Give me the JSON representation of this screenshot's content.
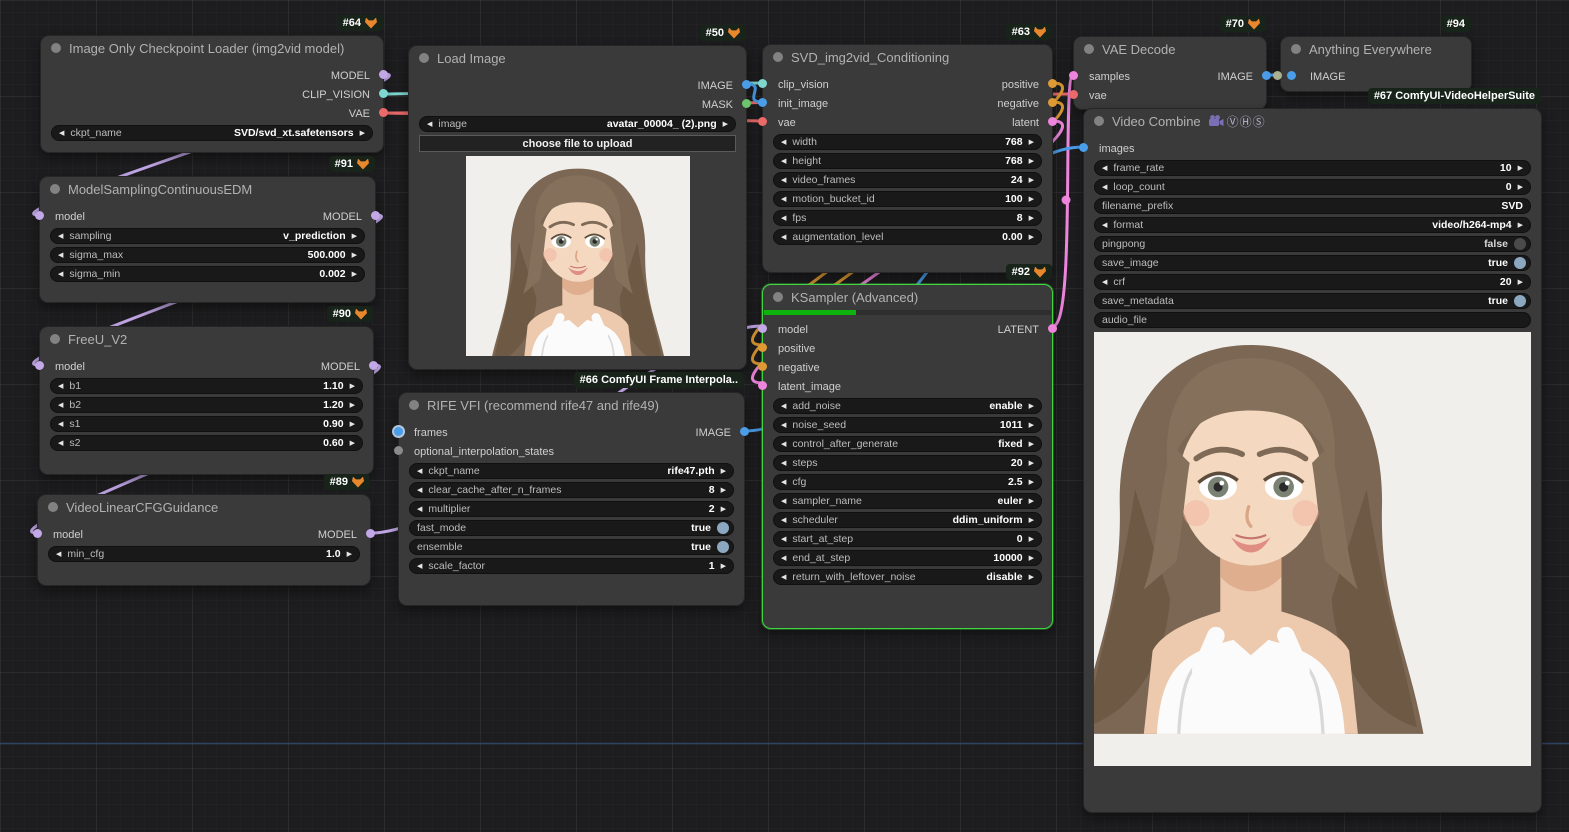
{
  "colors": {
    "model": "#c3a8e8",
    "clip_vision": "#7fd6cf",
    "vae": "#ea6a6a",
    "image": "#4a9de8",
    "mask": "#6cc46c",
    "conditioning": "#dd9933",
    "latent": "#ee85dd",
    "link_faint": "#35507c",
    "unconnected": "#8a8a8a",
    "anywhere_in": "#a8b08f",
    "progress": "#0eb30e"
  },
  "nodes": {
    "checkpoint_loader": {
      "badge": "#64",
      "title": "Image Only Checkpoint Loader (img2vid model)",
      "outputs": {
        "model": "MODEL",
        "clip_vision": "CLIP_VISION",
        "vae": "VAE"
      },
      "widgets": {
        "ckpt_name": {
          "label": "ckpt_name",
          "value": "SVD/svd_xt.safetensors"
        }
      }
    },
    "model_sampling": {
      "badge": "#91",
      "title": "ModelSamplingContinuousEDM",
      "inputs": {
        "model": "model"
      },
      "outputs": {
        "model": "MODEL"
      },
      "widgets": {
        "sampling": {
          "label": "sampling",
          "value": "v_prediction"
        },
        "sigma_max": {
          "label": "sigma_max",
          "value": "500.000"
        },
        "sigma_min": {
          "label": "sigma_min",
          "value": "0.002"
        }
      }
    },
    "freeu": {
      "badge": "#90",
      "title": "FreeU_V2",
      "inputs": {
        "model": "model"
      },
      "outputs": {
        "model": "MODEL"
      },
      "widgets": {
        "b1": {
          "label": "b1",
          "value": "1.10"
        },
        "b2": {
          "label": "b2",
          "value": "1.20"
        },
        "s1": {
          "label": "s1",
          "value": "0.90"
        },
        "s2": {
          "label": "s2",
          "value": "0.60"
        }
      }
    },
    "cfg_guidance": {
      "badge": "#89",
      "title": "VideoLinearCFGGuidance",
      "inputs": {
        "model": "model"
      },
      "outputs": {
        "model": "MODEL"
      },
      "widgets": {
        "min_cfg": {
          "label": "min_cfg",
          "value": "1.0"
        }
      }
    },
    "load_image": {
      "badge": "#50",
      "title": "Load Image",
      "outputs": {
        "image": "IMAGE",
        "mask": "MASK"
      },
      "widgets": {
        "image": {
          "label": "image",
          "value": "avatar_00004_ (2).png"
        },
        "upload": {
          "label": "choose file to upload"
        }
      }
    },
    "rife": {
      "badge": "#66 ComfyUI Frame Interpola..",
      "title": "RIFE VFI (recommend rife47 and rife49)",
      "inputs": {
        "frames": "frames",
        "optional": "optional_interpolation_states"
      },
      "outputs": {
        "image": "IMAGE"
      },
      "widgets": {
        "ckpt_name": {
          "label": "ckpt_name",
          "value": "rife47.pth"
        },
        "clear_cache": {
          "label": "clear_cache_after_n_frames",
          "value": "8"
        },
        "multiplier": {
          "label": "multiplier",
          "value": "2"
        },
        "fast_mode": {
          "label": "fast_mode",
          "value": "true"
        },
        "ensemble": {
          "label": "ensemble",
          "value": "true"
        },
        "scale_factor": {
          "label": "scale_factor",
          "value": "1"
        }
      }
    },
    "svd_conditioning": {
      "badge": "#63",
      "title": "SVD_img2vid_Conditioning",
      "inputs": {
        "clip_vision": "clip_vision",
        "init_image": "init_image",
        "vae": "vae"
      },
      "outputs": {
        "positive": "positive",
        "negative": "negative",
        "latent": "latent"
      },
      "widgets": {
        "width": {
          "label": "width",
          "value": "768"
        },
        "height": {
          "label": "height",
          "value": "768"
        },
        "video_frames": {
          "label": "video_frames",
          "value": "24"
        },
        "motion_bucket_id": {
          "label": "motion_bucket_id",
          "value": "100"
        },
        "fps": {
          "label": "fps",
          "value": "8"
        },
        "augmentation_level": {
          "label": "augmentation_level",
          "value": "0.00"
        }
      }
    },
    "ksampler": {
      "badge": "#92",
      "title": "KSampler (Advanced)",
      "inputs": {
        "model": "model",
        "positive": "positive",
        "negative": "negative",
        "latent_image": "latent_image"
      },
      "outputs": {
        "latent": "LATENT"
      },
      "widgets": {
        "add_noise": {
          "label": "add_noise",
          "value": "enable"
        },
        "noise_seed": {
          "label": "noise_seed",
          "value": "1011"
        },
        "control_after_generate": {
          "label": "control_after_generate",
          "value": "fixed"
        },
        "steps": {
          "label": "steps",
          "value": "20"
        },
        "cfg": {
          "label": "cfg",
          "value": "2.5"
        },
        "sampler_name": {
          "label": "sampler_name",
          "value": "euler"
        },
        "scheduler": {
          "label": "scheduler",
          "value": "ddim_uniform"
        },
        "start_at_step": {
          "label": "start_at_step",
          "value": "0"
        },
        "end_at_step": {
          "label": "end_at_step",
          "value": "10000"
        },
        "return_with_leftover_noise": {
          "label": "return_with_leftover_noise",
          "value": "disable"
        }
      }
    },
    "vae_decode": {
      "badge": "#70",
      "title": "VAE Decode",
      "inputs": {
        "samples": "samples",
        "vae": "vae"
      },
      "outputs": {
        "image": "IMAGE"
      }
    },
    "anything_everywhere": {
      "badge": "#94",
      "title": "Anything Everywhere",
      "inputs": {
        "image": "IMAGE"
      }
    },
    "video_combine": {
      "badge": "#67 ComfyUI-VideoHelperSuite",
      "title": "Video Combine",
      "title_icons": "ⓋⒽⓈ",
      "inputs": {
        "images": "images"
      },
      "widgets": {
        "frame_rate": {
          "label": "frame_rate",
          "value": "10"
        },
        "loop_count": {
          "label": "loop_count",
          "value": "0"
        },
        "filename_prefix": {
          "label": "filename_prefix",
          "value": "SVD"
        },
        "format": {
          "label": "format",
          "value": "video/h264-mp4"
        },
        "pingpong": {
          "label": "pingpong",
          "value": "false"
        },
        "save_image": {
          "label": "save_image",
          "value": "true"
        },
        "crf": {
          "label": "crf",
          "value": "20"
        },
        "save_metadata": {
          "label": "save_metadata",
          "value": "true"
        },
        "audio_file": {
          "label": "audio_file"
        }
      }
    }
  }
}
